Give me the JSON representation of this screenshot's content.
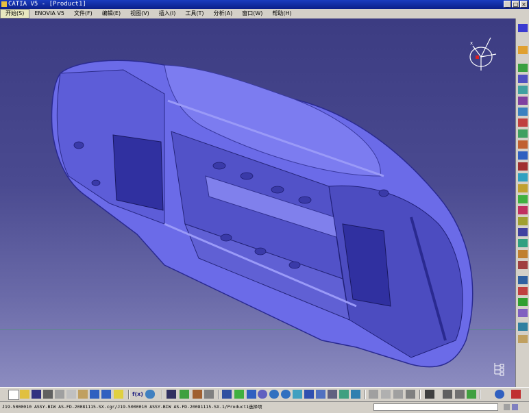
{
  "window": {
    "title": "CATIA V5 - [Product1]",
    "buttons": [
      "minimize",
      "maximize",
      "close"
    ],
    "button_glyphs": [
      "_",
      "□",
      "×"
    ]
  },
  "menu": {
    "items": [
      "开始(S)",
      "ENOVIA V5",
      "文件(F)",
      "编辑(E)",
      "视图(V)",
      "插入(I)",
      "工具(T)",
      "分析(A)",
      "窗口(W)",
      "帮助(H)"
    ],
    "active_index": 0
  },
  "viewport": {
    "background_top": "#3c3c82",
    "background_bottom": "#8c8cc0",
    "model_color": "#6b6be8",
    "compass_label": "x"
  },
  "right_toolbar": {
    "icons": [
      "plane-icon",
      "sketch-icon",
      "pad-icon",
      "pocket-icon",
      "shaft-icon",
      "groove-icon",
      "hole-icon",
      "rib-icon",
      "slot-icon",
      "stiffener-icon",
      "loft-icon",
      "shell-icon",
      "thickness-icon",
      "draft-icon",
      "fillet-icon",
      "chamfer-icon",
      "mirror-icon",
      "pattern-icon",
      "scale-icon",
      "split-icon",
      "boolean-icon",
      "constraint-icon",
      "measure-icon",
      "render-icon",
      "catalog-icon",
      "axis-icon",
      "material-icon"
    ]
  },
  "bottom_toolbar": {
    "icons": [
      "new-icon",
      "open-icon",
      "save-icon",
      "print-icon",
      "cut-icon",
      "copy-icon",
      "paste-icon",
      "undo-icon",
      "redo-icon",
      "whats-this-icon",
      "formula-icon",
      "knowledge-icon",
      "fit-all-icon",
      "pan-icon",
      "rotate-icon",
      "zoom-in-icon",
      "zoom-out-icon",
      "normal-view-icon",
      "multi-view-icon",
      "iso-view-icon",
      "shading-icon",
      "hide-show-icon",
      "swap-space-icon",
      "apply-material-icon",
      "measure-icon",
      "catalog-icon",
      "product-icon"
    ],
    "formula_label": "f(x)"
  },
  "status": {
    "text": "J19-5000010    ASSY-BIW                 AS-FD-20081115-SX.cgr/J19-5000010    ASSY-BIW                 AS-FD-20081115-SX.1/Product1选择项",
    "command_input": ""
  }
}
